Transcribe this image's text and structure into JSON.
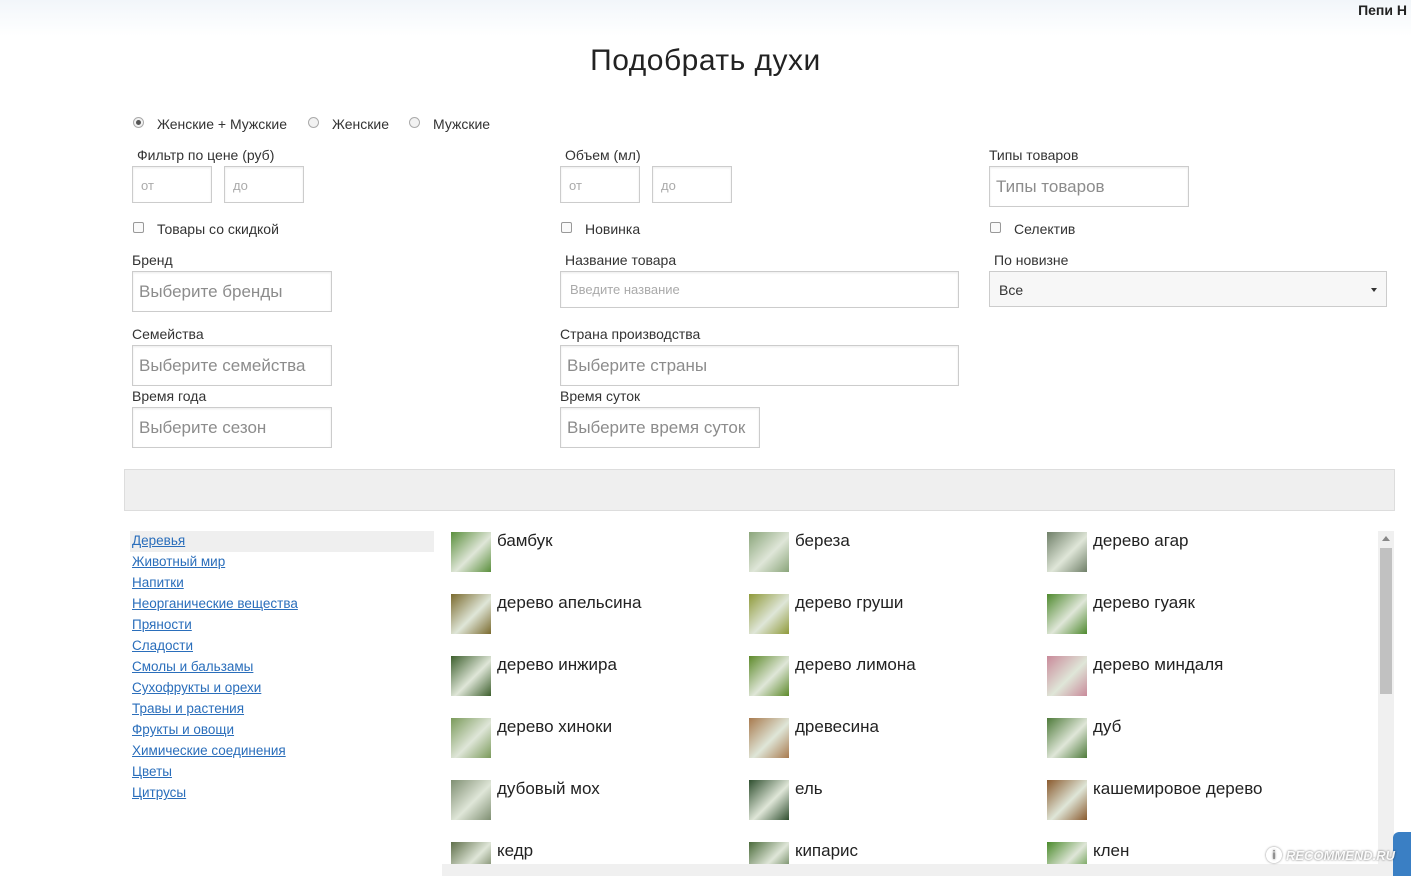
{
  "header": {
    "user_name": "Пепи Н"
  },
  "page_title": "Подобрать духи",
  "gender": {
    "options": [
      "Женские + Мужские",
      "Женские",
      "Мужские"
    ],
    "selected": "Женские + Мужские"
  },
  "filters": {
    "price": {
      "label": "Фильтр по цене (руб)",
      "from_placeholder": "от",
      "to_placeholder": "до"
    },
    "volume": {
      "label": "Объем (мл)",
      "from_placeholder": "от",
      "to_placeholder": "до"
    },
    "product_types": {
      "label": "Типы товаров",
      "placeholder": "Типы товаров"
    },
    "discount": {
      "label": "Товары со скидкой",
      "checked": false
    },
    "novelty": {
      "label": "Новинка",
      "checked": false
    },
    "selective": {
      "label": "Селектив",
      "checked": false
    },
    "brand": {
      "label": "Бренд",
      "placeholder": "Выберите бренды"
    },
    "product_name": {
      "label": "Название товара",
      "placeholder": "Введите название"
    },
    "sort_novelty": {
      "label": "По новизне",
      "value": "Все"
    },
    "families": {
      "label": "Семейства",
      "placeholder": "Выберите семейства"
    },
    "country": {
      "label": "Страна производства",
      "placeholder": "Выберите страны"
    },
    "season": {
      "label": "Время года",
      "placeholder": "Выберите сезон"
    },
    "daytime": {
      "label": "Время суток",
      "placeholder": "Выберите время суток"
    }
  },
  "categories": {
    "active": "Деревья",
    "items": [
      "Деревья",
      "Животный мир",
      "Напитки",
      "Неорганические вещества",
      "Пряности",
      "Сладости",
      "Смолы и бальзамы",
      "Сухофрукты и орехи",
      "Травы и растения",
      "Фрукты и овощи",
      "Химические соединения",
      "Цветы",
      "Цитрусы"
    ]
  },
  "notes": [
    {
      "label": "бамбук",
      "icon": "bamboo-icon",
      "color": "#5a8f3c"
    },
    {
      "label": "береза",
      "icon": "birch-icon",
      "color": "#8aa57a"
    },
    {
      "label": "дерево агар",
      "icon": "agar-tree-icon",
      "color": "#6f7f68"
    },
    {
      "label": "дерево апельсина",
      "icon": "orange-tree-icon",
      "color": "#7a6a2e"
    },
    {
      "label": "дерево груши",
      "icon": "pear-tree-icon",
      "color": "#8f9a3a"
    },
    {
      "label": "дерево гуаяк",
      "icon": "guaiac-tree-icon",
      "color": "#4f8a2f"
    },
    {
      "label": "дерево инжира",
      "icon": "fig-tree-icon",
      "color": "#3d5f2d"
    },
    {
      "label": "дерево лимона",
      "icon": "lemon-tree-icon",
      "color": "#5d8a2a"
    },
    {
      "label": "дерево миндаля",
      "icon": "almond-tree-icon",
      "color": "#c98a9a"
    },
    {
      "label": "дерево хиноки",
      "icon": "hinoki-tree-icon",
      "color": "#7a9a5a"
    },
    {
      "label": "древесина",
      "icon": "wood-logs-icon",
      "color": "#a87a4e"
    },
    {
      "label": "дуб",
      "icon": "oak-tree-icon",
      "color": "#4e7a3a"
    },
    {
      "label": "дубовый мох",
      "icon": "oakmoss-icon",
      "color": "#7f8f72"
    },
    {
      "label": "ель",
      "icon": "spruce-icon",
      "color": "#2f4f2f"
    },
    {
      "label": "кашемировое дерево",
      "icon": "elephant-icon",
      "color": "#8a5a2e"
    },
    {
      "label": "кедр",
      "icon": "cedar-icon",
      "color": "#5f6f4a"
    },
    {
      "label": "кипарис",
      "icon": "cypress-icon",
      "color": "#4a6a3a"
    },
    {
      "label": "клен",
      "icon": "maple-icon",
      "color": "#4a8a2a"
    }
  ],
  "watermark": "RECOMMEND.RU"
}
